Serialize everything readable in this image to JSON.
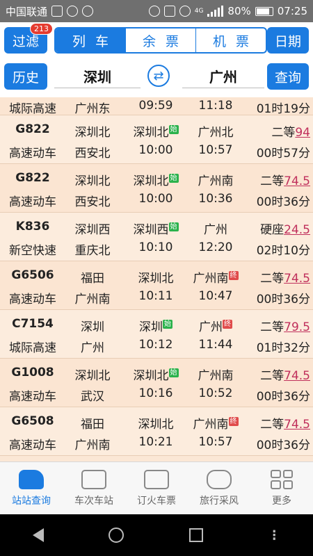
{
  "status": {
    "carrier": "中国联通",
    "network": "4G",
    "battery": "80%",
    "time": "07:25"
  },
  "toolbar": {
    "filter_label": "过滤",
    "filter_badge": "213",
    "tabs": [
      {
        "label": "列车",
        "active": true
      },
      {
        "label": "余票",
        "active": false
      },
      {
        "label": "机票",
        "active": false
      }
    ],
    "date_label": "日期",
    "history_label": "历史",
    "from_city": "深圳",
    "to_city": "广州",
    "swap_icon": "⇄",
    "query_label": "查询"
  },
  "trains": [
    {
      "code": "",
      "type": "城际高速",
      "from_station": "广州东",
      "depart_station": "",
      "start_tag": "",
      "arrive_station": "",
      "end_tag": "",
      "seat": "",
      "price": "",
      "depart": "09:59",
      "arrive": "11:18",
      "duration": "01时19分",
      "partial": true
    },
    {
      "code": "G822",
      "type": "高速动车",
      "from_station": "深圳北",
      "to_station": "西安北",
      "depart_station": "深圳北",
      "start_tag": "始",
      "arrive_station": "广州北",
      "end_tag": "",
      "seat": "二等",
      "price": "94",
      "depart": "10:00",
      "arrive": "10:57",
      "duration": "00时57分"
    },
    {
      "code": "G822",
      "type": "高速动车",
      "from_station": "深圳北",
      "to_station": "西安北",
      "depart_station": "深圳北",
      "start_tag": "始",
      "arrive_station": "广州南",
      "end_tag": "",
      "seat": "二等",
      "price": "74.5",
      "depart": "10:00",
      "arrive": "10:36",
      "duration": "00时36分"
    },
    {
      "code": "K836",
      "type": "新空快速",
      "from_station": "深圳西",
      "to_station": "重庆北",
      "depart_station": "深圳西",
      "start_tag": "始",
      "arrive_station": "广州",
      "end_tag": "",
      "seat": "硬座",
      "price": "24.5",
      "depart": "10:10",
      "arrive": "12:20",
      "duration": "02时10分"
    },
    {
      "code": "G6506",
      "type": "高速动车",
      "from_station": "福田",
      "to_station": "广州南",
      "depart_station": "深圳北",
      "start_tag": "",
      "arrive_station": "广州南",
      "end_tag": "终",
      "seat": "二等",
      "price": "74.5",
      "depart": "10:11",
      "arrive": "10:47",
      "duration": "00时36分"
    },
    {
      "code": "C7154",
      "type": "城际高速",
      "from_station": "深圳",
      "to_station": "广州",
      "depart_station": "深圳",
      "start_tag": "始",
      "arrive_station": "广州",
      "end_tag": "终",
      "seat": "二等",
      "price": "79.5",
      "depart": "10:12",
      "arrive": "11:44",
      "duration": "01时32分"
    },
    {
      "code": "G1008",
      "type": "高速动车",
      "from_station": "深圳北",
      "to_station": "武汉",
      "depart_station": "深圳北",
      "start_tag": "始",
      "arrive_station": "广州南",
      "end_tag": "",
      "seat": "二等",
      "price": "74.5",
      "depart": "10:16",
      "arrive": "10:52",
      "duration": "00时36分"
    },
    {
      "code": "G6508",
      "type": "高速动车",
      "from_station": "福田",
      "to_station": "广州南",
      "depart_station": "深圳北",
      "start_tag": "",
      "arrive_station": "广州南",
      "end_tag": "终",
      "seat": "二等",
      "price": "74.5",
      "depart": "10:21",
      "arrive": "10:57",
      "duration": "00时36分"
    }
  ],
  "bottom_nav": [
    {
      "label": "站站查询",
      "icon": "train-icon",
      "active": true
    },
    {
      "label": "车次车站",
      "icon": "briefcase-icon",
      "active": false
    },
    {
      "label": "订火车票",
      "icon": "ticket-icon",
      "active": false
    },
    {
      "label": "旅行采风",
      "icon": "chat-icon",
      "active": false
    },
    {
      "label": "更多",
      "icon": "grid-icon",
      "active": false
    }
  ]
}
